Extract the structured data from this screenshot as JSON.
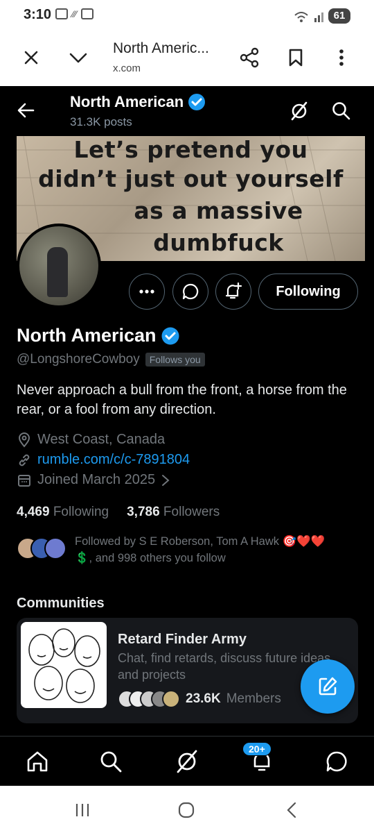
{
  "status_bar": {
    "time": "3:10",
    "battery": "61"
  },
  "browser": {
    "title": "North Americ...",
    "url": "x.com"
  },
  "header": {
    "name": "North American",
    "posts": "31.3K posts"
  },
  "banner": {
    "lines": [
      "Let’s pretend you",
      "didn’t just out yourself",
      "as a massive",
      "dumbfuck"
    ]
  },
  "profile": {
    "follow_button": "Following",
    "name": "North American",
    "handle": "@LongshoreCowboy",
    "follows_you": "Follows you",
    "bio": "Never approach a bull from the front, a horse from the rear, or a fool from any direction.",
    "location": "West Coast, Canada",
    "link": "rumble.com/c/c-7891804",
    "joined": "Joined March 2025",
    "following_count": "4,469",
    "following_label": "Following",
    "followers_count": "3,786",
    "followers_label": "Followers",
    "followed_by": "Followed by S E Roberson, Tom A Hawk 🎯❤️❤️",
    "followed_by_more": "💲, and 998 others you follow"
  },
  "communities": {
    "heading": "Communities",
    "name": "Retard Finder Army",
    "description": "Chat, find retards, discuss future ideas and projects",
    "members_count": "23.6K",
    "members_label": "Members"
  },
  "tabbar": {
    "notification_badge": "20+"
  },
  "colors": {
    "accent": "#1d9bf0",
    "background": "#000000",
    "secondary_text": "#71767b"
  }
}
